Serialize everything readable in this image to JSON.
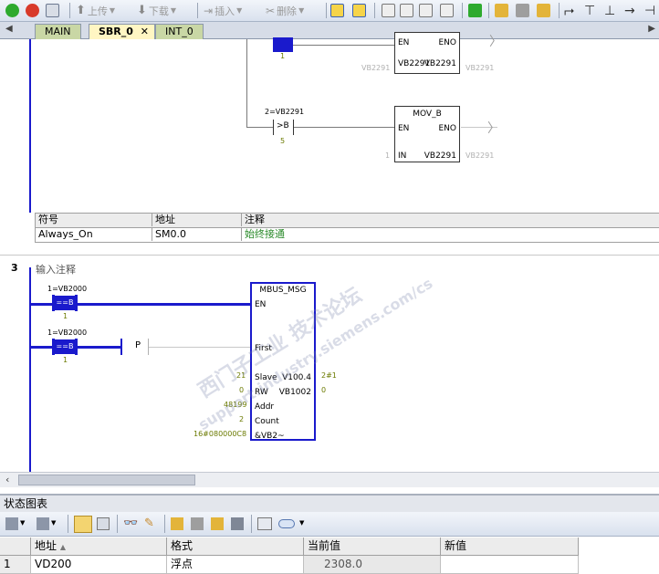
{
  "toolbar": {
    "upload_label": "上传",
    "download_label": "下载",
    "insert_label": "插入",
    "delete_label": "删除"
  },
  "tabs": [
    {
      "label": "MAIN"
    },
    {
      "label": "SBR_0"
    },
    {
      "label": "INT_0"
    }
  ],
  "network2": {
    "top_box": {
      "en": "EN",
      "eno": "ENO",
      "in_left": "VB2291",
      "in_right": "VB2291",
      "out_left": "VB2291",
      "out_right": "VB2291",
      "contact_param": "1"
    },
    "compare": {
      "operand_top": "2=VB2291",
      "op": ">B",
      "value": "5"
    },
    "mov_b": {
      "title": "MOV_B",
      "en": "EN",
      "eno": "ENO",
      "in": "IN",
      "in_value": "1",
      "out_label": "VB2291",
      "out_value": "VB2291"
    }
  },
  "symbol_table": {
    "headers": [
      "符号",
      "地址",
      "注释"
    ],
    "rows": [
      {
        "symbol": "Always_On",
        "address": "SM0.0",
        "comment": "始终接通"
      }
    ]
  },
  "network3": {
    "number": "3",
    "comment": "输入注释",
    "contact1": {
      "operand": "1=VB2000",
      "op": "==B",
      "value": "1"
    },
    "contact2": {
      "operand": "1=VB2000",
      "op": "==B",
      "value": "1"
    },
    "p_label": "P",
    "mbus": {
      "title": "MBUS_MSG",
      "en": "EN",
      "first": "First",
      "slave": "Slave",
      "rw": "RW",
      "addr": "Addr",
      "count": "Count",
      "ptr": "&VB2~",
      "done": "V100.4",
      "error": "VB1002",
      "slave_val": "21",
      "rw_val": "0",
      "addr_val": "48199",
      "count_val": "2",
      "ptr_val": "16#080000C8",
      "done_val": "2#1",
      "error_val": "0"
    }
  },
  "watermark": {
    "line1": "西门子工业  技术论坛",
    "line2": "support.industry.siemens.com/cs"
  },
  "status_chart": {
    "title": "状态图表",
    "headers": [
      "",
      "地址",
      "格式",
      "当前值",
      "新值"
    ],
    "rows": [
      {
        "index": "1",
        "address": "VD200",
        "format": "浮点",
        "current": "2308.0",
        "new": ""
      }
    ]
  }
}
